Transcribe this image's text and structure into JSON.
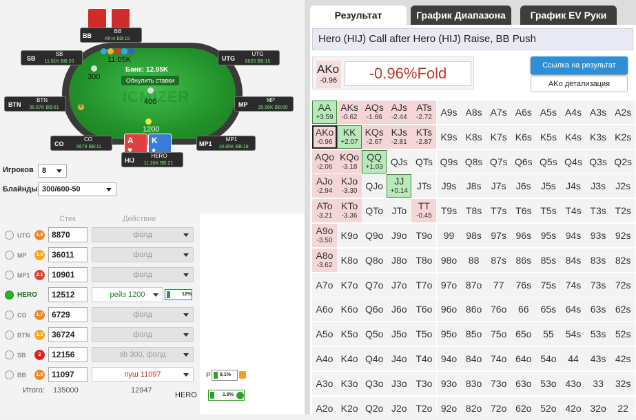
{
  "colors": {
    "neg": "#f4d6d6",
    "pos": "#b9e8b9",
    "accent": "#2f8fd6",
    "felt": "#23922b"
  },
  "tabs": [
    "Результат",
    "График Диапазона",
    "График EV Руки"
  ],
  "result": {
    "title": "Hero (HIJ) Call after Hero (HIJ) Raise, BB Push",
    "hand": "AKo",
    "hand_ev": "-0.96",
    "value": "-0.96%Fold",
    "link_button": "Ссылка на результат",
    "detail_button": "AKo детализация"
  },
  "grid": {
    "ranks": [
      "A",
      "K",
      "Q",
      "J",
      "T",
      "9",
      "8",
      "7",
      "6",
      "5",
      "4",
      "3",
      "2"
    ],
    "ev": {
      "AA": "+3.59",
      "AKs": "-0.62",
      "AQs": "-1.66",
      "AJs": "-2.44",
      "ATs": "-2.72",
      "AKo": "-0.96",
      "KK": "+2.07",
      "KQs": "-2.67",
      "KJs": "-2.81",
      "KTs": "-2.87",
      "AQo": "-2.06",
      "KQo": "-3.18",
      "QQ": "+1.03",
      "AJo": "-2.94",
      "KJo": "-3.30",
      "JJ": "+0.14",
      "ATo": "-3.21",
      "KTo": "-3.36",
      "TT": "-0.45",
      "A9o": "-3.50",
      "A8o": "-3.62"
    }
  },
  "table": {
    "pot": "Банк: 12.95K",
    "reset": "Обнулить ставки",
    "watermark": "ICMIZER",
    "seats": [
      {
        "pos": "BB",
        "name": "BB",
        "stack": "All-in BB:18"
      },
      {
        "pos": "SB",
        "name": "SB",
        "stack": "11.81K BB:20"
      },
      {
        "pos": "UTG",
        "name": "UTG",
        "stack": "8820 BB:15"
      },
      {
        "pos": "BTN",
        "name": "BTN",
        "stack": "36.67K BB:61"
      },
      {
        "pos": "MP",
        "name": "MP",
        "stack": "35.96K BB:60"
      },
      {
        "pos": "CO",
        "name": "CO",
        "stack": "6679 BB:11"
      },
      {
        "pos": "MP1",
        "name": "MP1",
        "stack": "10.85K BB:18"
      },
      {
        "pos": "HIJ",
        "name": "HERO",
        "stack": "11.26K BB:21"
      }
    ],
    "bets": {
      "bb": "11.05K",
      "sb": "300",
      "mp1": "400",
      "hero": "1200"
    },
    "hero_cards": [
      {
        "rank": "A",
        "suit": "♥"
      },
      {
        "rank": "K",
        "suit": "♦"
      }
    ]
  },
  "controls": {
    "players_label": "Игроков",
    "players_value": "8",
    "blinds_label": "Блайнды",
    "blinds_value": "300/600-50",
    "stack_header": "Стек",
    "action_header": "Действие",
    "rows": [
      {
        "pos": "UTG",
        "badge": "1.8",
        "badge_color": "#f08a24",
        "stack": "8870",
        "action": "фолд",
        "style": ""
      },
      {
        "pos": "MP",
        "badge": "1.3",
        "badge_color": "#f0a820",
        "stack": "36011",
        "action": "фолд",
        "style": ""
      },
      {
        "pos": "MP1",
        "badge": "2.1",
        "badge_color": "#e04030",
        "stack": "10901",
        "action": "фолд",
        "style": ""
      },
      {
        "pos": "HERO",
        "badge": "",
        "badge_color": "",
        "stack": "12512",
        "action": "рейз 1200",
        "style": "green",
        "pct": "12%"
      },
      {
        "pos": "CO",
        "badge": "1.7",
        "badge_color": "#f08a24",
        "stack": "6729",
        "action": "фолд",
        "style": ""
      },
      {
        "pos": "BTN",
        "badge": "1.3",
        "badge_color": "#f0a820",
        "stack": "36724",
        "action": "фолд",
        "style": ""
      },
      {
        "pos": "SB",
        "badge": "2",
        "badge_color": "#e02020",
        "stack": "12156",
        "action": "sb 300, фолд",
        "style": ""
      },
      {
        "pos": "BB",
        "badge": "1.8",
        "badge_color": "#f08a24",
        "stack": "11097",
        "action": "пуш 11097",
        "style": "red"
      }
    ],
    "total_label": "Итого:",
    "total_stack": "135000",
    "total_bet": "12947",
    "p_label": "P",
    "p_pct": "8.1%",
    "hero_label": "HERO",
    "hero_pct": "1.8%"
  }
}
